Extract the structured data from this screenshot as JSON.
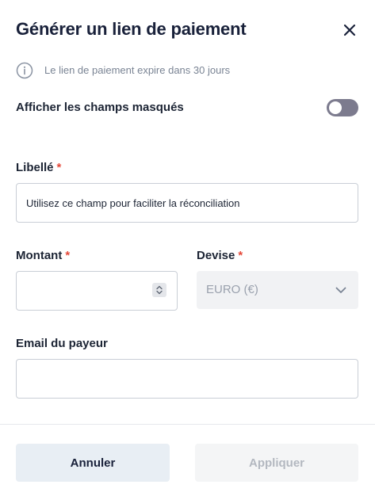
{
  "modal": {
    "title": "Générer un lien de paiement",
    "info_text": "Le lien de paiement expire dans 30 jours"
  },
  "toggle": {
    "label": "Afficher les champs masqués",
    "checked": false
  },
  "fields": {
    "label": {
      "label": "Libellé",
      "required_mark": "*",
      "placeholder": "Utilisez ce champ pour faciliter la réconciliation",
      "value": ""
    },
    "amount": {
      "label": "Montant",
      "required_mark": "*",
      "value": ""
    },
    "currency": {
      "label": "Devise",
      "required_mark": "*",
      "selected": "EURO (€)"
    },
    "payer_email": {
      "label": "Email du payeur",
      "value": ""
    }
  },
  "actions": {
    "cancel_label": "Annuler",
    "apply_label": "Appliquer"
  },
  "colors": {
    "primary_text": "#19213a",
    "required": "#e5493a",
    "toggle_off": "#7c7b8e",
    "cancel_bg": "#e8eef4",
    "apply_disabled_bg": "#f4f5f6"
  },
  "icons": {
    "close": "close-icon",
    "info": "info-icon",
    "stepper": "stepper-icon",
    "chevron": "chevron-down-icon"
  }
}
